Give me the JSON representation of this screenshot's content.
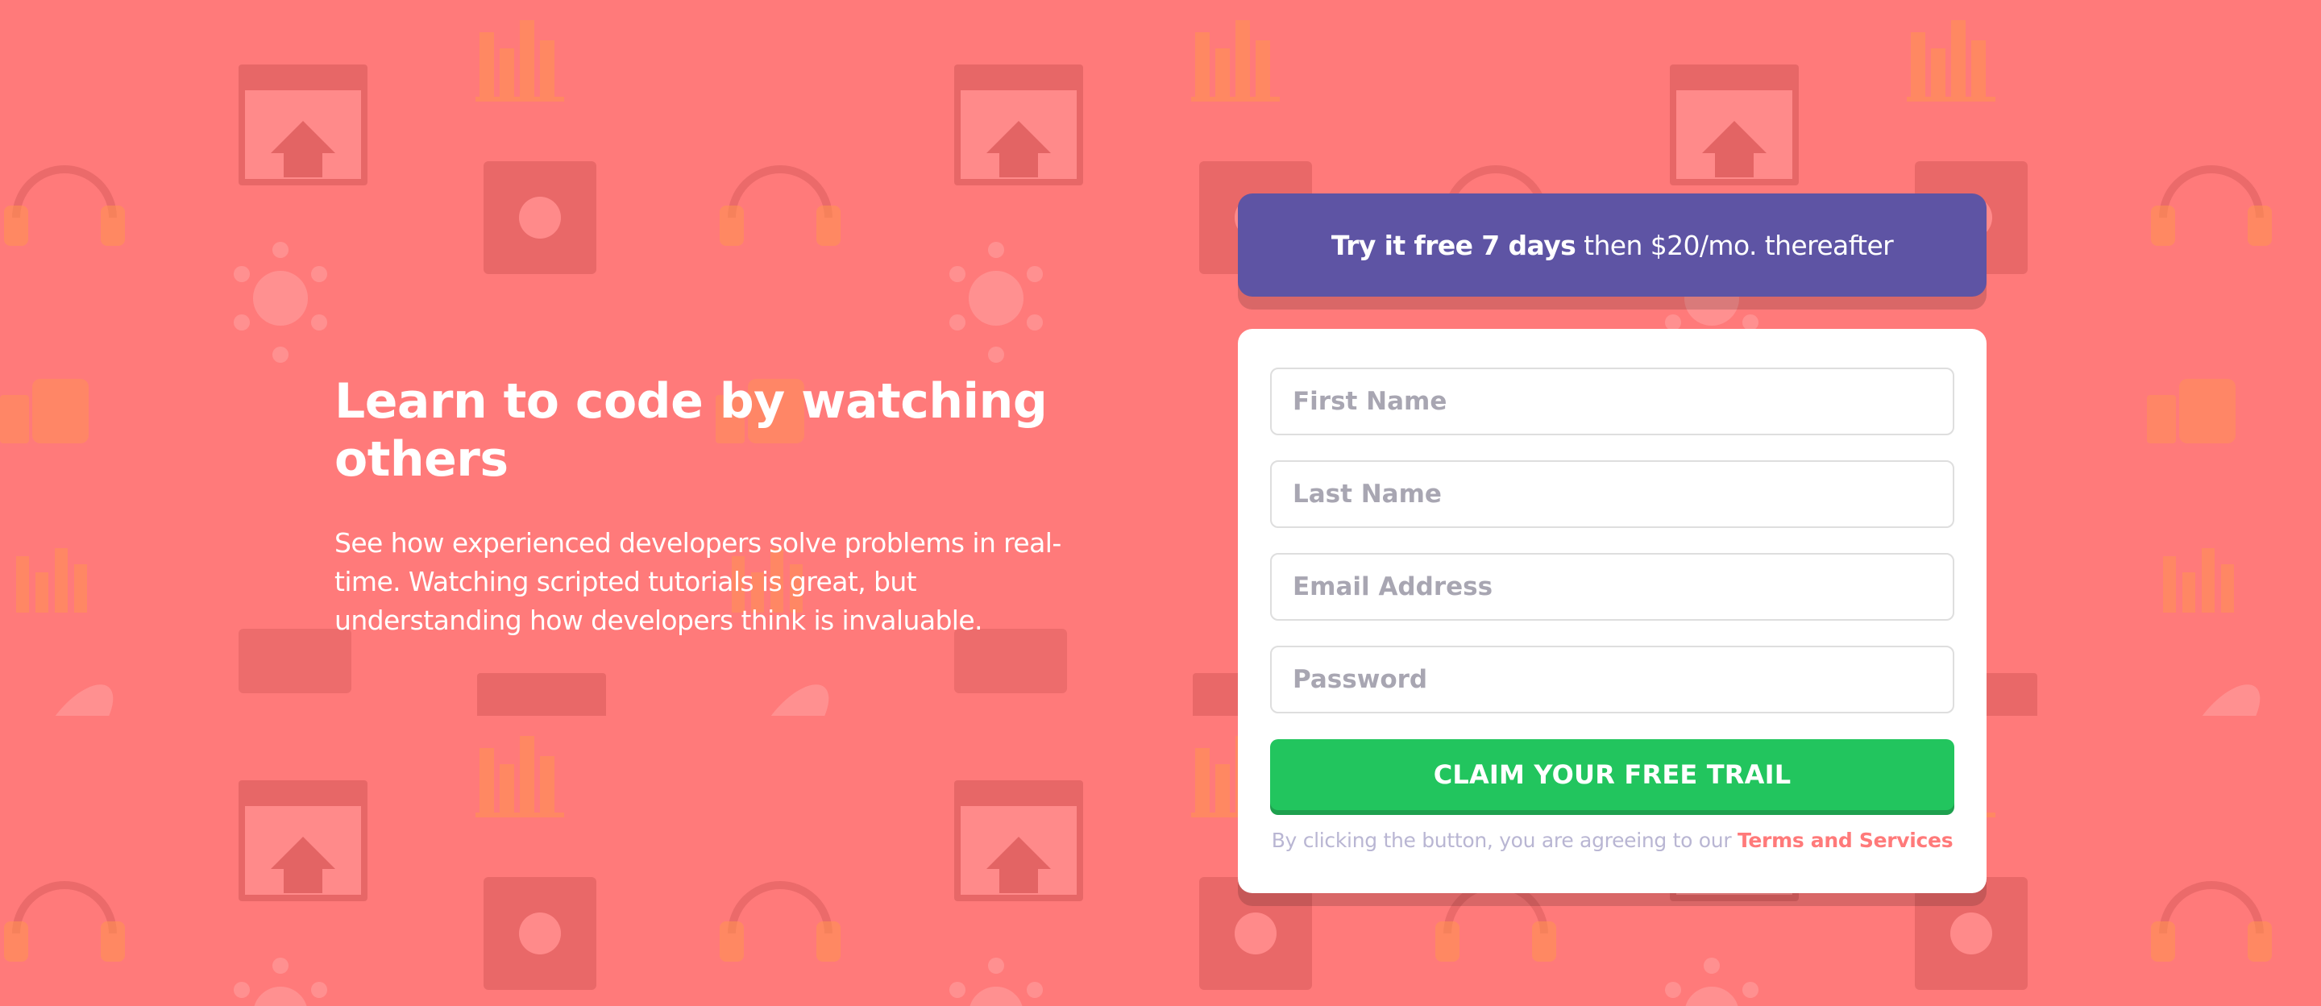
{
  "hero": {
    "title": "Learn to code by watching others",
    "description": "See how experienced developers solve problems in real-time. Watching scripted tutorials is great, but understanding how developers think is invaluable."
  },
  "promo": {
    "bold_text": "Try it free 7 days",
    "rest_text": "then $20/mo. thereafter"
  },
  "form": {
    "first_name_placeholder": "First Name",
    "last_name_placeholder": "Last Name",
    "email_placeholder": "Email Address",
    "password_placeholder": "Password",
    "submit_label": "CLAIM YOUR FREE TRAIL",
    "terms_text": "By clicking the button, you are agreeing to our",
    "terms_link": "Terms and Services"
  },
  "colors": {
    "background": "#ff7a7a",
    "accent_purple": "#5e54a4",
    "accent_green": "#22c55e",
    "link_red": "#ff7a7a"
  },
  "icons": [
    "bg-pattern-icon"
  ]
}
